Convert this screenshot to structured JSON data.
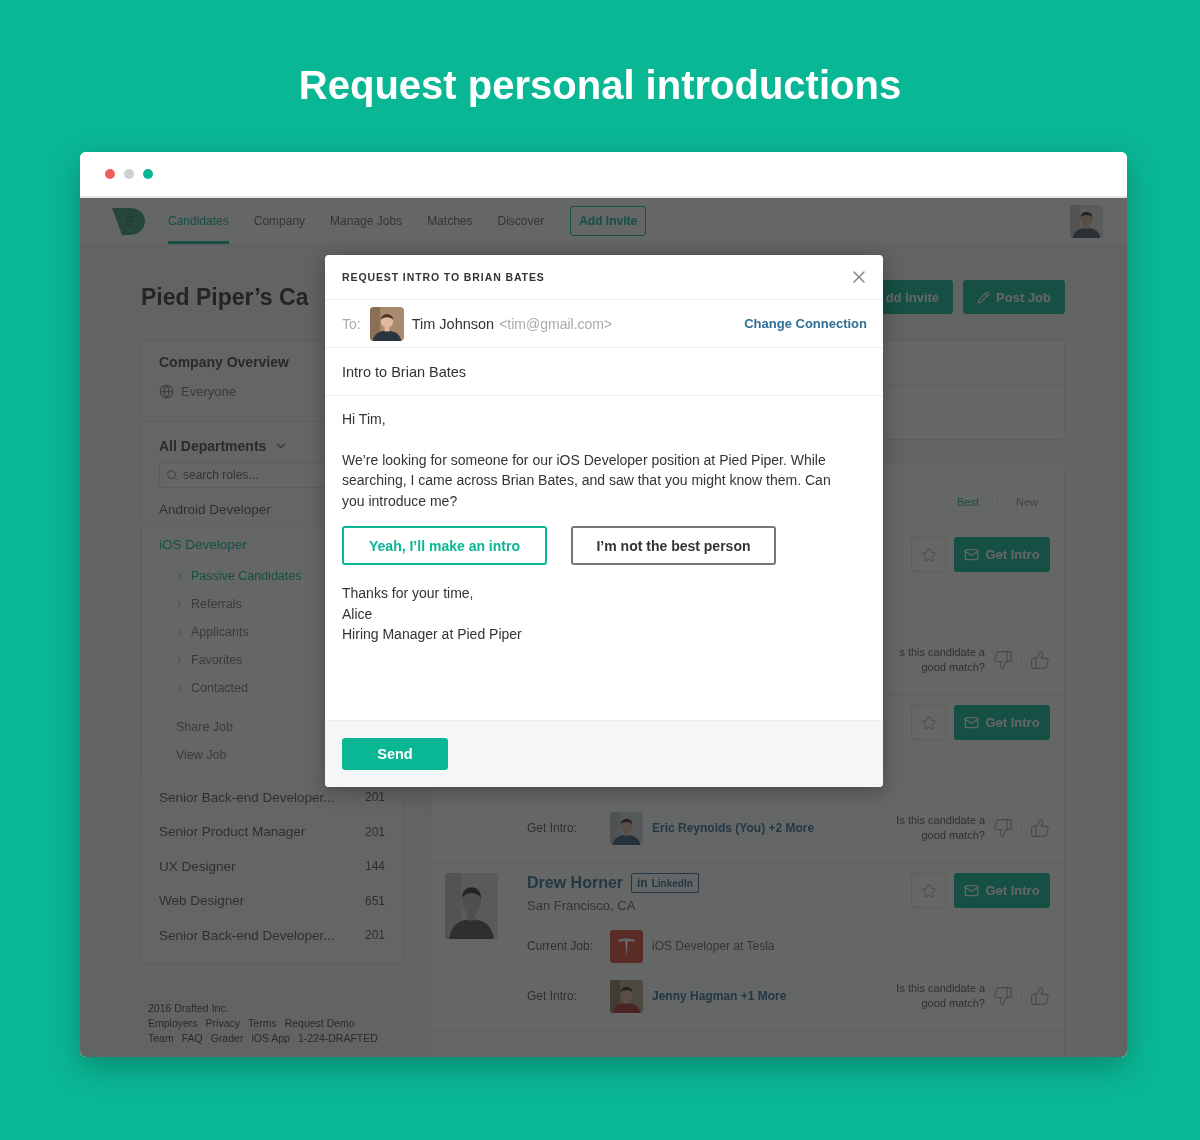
{
  "headline": "Request personal introductions",
  "browser": {
    "dots": [
      {
        "color": "#ee5e5a"
      },
      {
        "color": "#cfcfcf"
      },
      {
        "color": "#0ab795"
      }
    ]
  },
  "nav": {
    "tabs": [
      {
        "label": "Candidates",
        "selected": true
      },
      {
        "label": "Company",
        "selected": false
      },
      {
        "label": "Manage Jobs",
        "selected": false
      },
      {
        "label": "Matches",
        "selected": false
      },
      {
        "label": "Discover",
        "selected": false
      }
    ],
    "invite_button": "Add Invite"
  },
  "page": {
    "title": "Pied Piper’s Ca",
    "buttons": [
      {
        "label": "dd Invite",
        "kind": "plain"
      },
      {
        "label": "Post Job",
        "kind": "pencil"
      }
    ]
  },
  "sidebar": {
    "heading": "Company Overview",
    "visibility": "Everyone",
    "department": "All Departments",
    "search": {
      "placeholder": "search roles..."
    },
    "jobs": [
      {
        "title": "Android Developer",
        "selected": false
      },
      {
        "title": "iOS Developer",
        "selected": true,
        "children": [
          {
            "label": "Passive Candidates",
            "selected": true
          },
          {
            "label": "Referrals",
            "selected": false
          },
          {
            "label": "Applicants",
            "selected": false
          },
          {
            "label": "Favorites",
            "selected": false
          },
          {
            "label": "Contacted",
            "selected": false
          }
        ],
        "actions": [
          "Share Job",
          "View Job"
        ]
      },
      {
        "title": "Senior Back-end Developer...",
        "count": "201",
        "selected": false
      },
      {
        "title": "Senior Product Manager",
        "count": "201",
        "selected": false
      },
      {
        "title": "UX Designer",
        "count": "144",
        "selected": false
      },
      {
        "title": "Web Designer",
        "count": "651",
        "selected": false
      },
      {
        "title": "Senior Back-end Developer...",
        "count": "201",
        "selected": false
      }
    ],
    "footer": {
      "copyright": "2016 Drafted Inc.",
      "links": [
        [
          "Employers",
          "Privacy",
          "Terms",
          "Request Demo"
        ],
        [
          "Team",
          "FAQ",
          "Grader",
          "iOS App",
          "1-224-DRAFTED"
        ]
      ]
    }
  },
  "results": {
    "sort": [
      {
        "label": "Best",
        "selected": true
      },
      {
        "label": "New",
        "selected": false
      }
    ],
    "candidates": [
      {
        "action": "Get Intro",
        "question": "s this candidate a good match?"
      },
      {
        "action": "Get Intro",
        "intro": {
          "label": "Get Intro:",
          "names": "Eric Reynolds (You) +2 More"
        },
        "question": "Is this candidate a good match?"
      },
      {
        "action": "Get Intro",
        "name": "Drew Horner",
        "badge": {
          "mark": "in",
          "label": "LinkedIn"
        },
        "location": "San Francisco, CA",
        "job": {
          "label": "Current Job:",
          "text": "iOS Developer at Tesla"
        },
        "intro": {
          "label": "Get Intro:",
          "names": "Jenny Hagman +1 More"
        },
        "question": "Is this candidate a good match?"
      }
    ]
  },
  "modal": {
    "title": "REQUEST INTRO TO BRIAN BATES",
    "to_label": "To:",
    "recipient": "Tim Johnson",
    "email": "<tim@gmail.com>",
    "change": "Change Connection",
    "subject": "Intro to Brian Bates",
    "greeting": "Hi Tim,",
    "message": "We’re looking for someone for our iOS Developer position at Pied Piper. While searching, I came across Brian Bates, and saw that you might know them. Can you introduce me?",
    "choices": [
      {
        "label": "Yeah, I’ll make an intro",
        "kind": "primary"
      },
      {
        "label": "I’m not the best person",
        "kind": "secondary"
      }
    ],
    "signoff": [
      "Thanks for your time,",
      "Alice",
      "Hiring Manager at Pied Piper"
    ],
    "send": "Send"
  }
}
